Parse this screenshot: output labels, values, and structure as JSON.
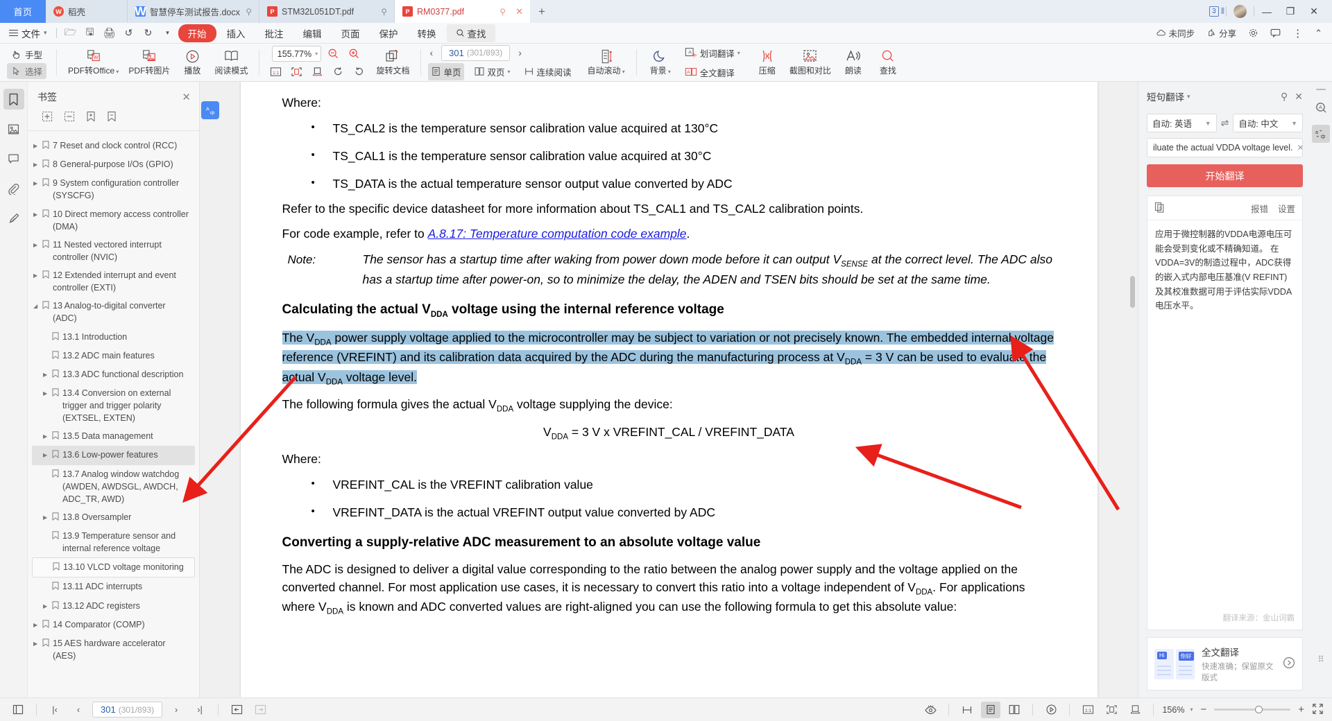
{
  "window": {
    "tabs": [
      {
        "label": "首页",
        "type": "home"
      },
      {
        "label": "稻壳",
        "type": "wps"
      },
      {
        "label": "智慧停车测试报告.docx",
        "type": "doc"
      },
      {
        "label": "STM32L051DT.pdf",
        "type": "pdf"
      },
      {
        "label": "RM0377.pdf",
        "type": "pdf"
      }
    ],
    "add_tab": "+",
    "tab_count": "3",
    "minimize": "—",
    "restore": "❐",
    "close": "✕"
  },
  "menubar": {
    "file": "文件",
    "items": [
      "开始",
      "插入",
      "批注",
      "编辑",
      "页面",
      "保护",
      "转换"
    ],
    "find": "查找",
    "right": [
      "未同步",
      "分享"
    ]
  },
  "toolbar": {
    "hand": "手型",
    "select": "选择",
    "pdf_to_office": "PDF转Office",
    "pdf_to_image": "PDF转图片",
    "play": "播放",
    "read_mode": "阅读模式",
    "zoom_value": "155.77%",
    "rotate_doc": "旋转文档",
    "page_current": "301",
    "page_total": "(301/893)",
    "single_page": "单页",
    "double_page": "双页",
    "continuous": "连续阅读",
    "auto_scroll": "自动滚动",
    "background": "背景",
    "word_translate": "划词翻译",
    "full_translate": "全文翻译",
    "compress": "压缩",
    "screenshot_compare": "截图和对比",
    "read_aloud": "朗读",
    "find": "查找"
  },
  "bookmarks": {
    "title": "书签",
    "items": [
      {
        "label": "7 Reset and clock control (RCC)",
        "level": 1,
        "arrow": true
      },
      {
        "label": "8 General-purpose I/Os (GPIO)",
        "level": 1,
        "arrow": true
      },
      {
        "label": "9 System configuration controller (SYSCFG)",
        "level": 1,
        "arrow": true
      },
      {
        "label": "10 Direct memory access controller (DMA)",
        "level": 1,
        "arrow": true
      },
      {
        "label": "11 Nested vectored interrupt controller (NVIC)",
        "level": 1,
        "arrow": true
      },
      {
        "label": "12 Extended interrupt and event controller (EXTI)",
        "level": 1,
        "arrow": true
      },
      {
        "label": "13 Analog-to-digital converter (ADC)",
        "level": 1,
        "arrow": true,
        "expanded": true
      },
      {
        "label": "13.1 Introduction",
        "level": 2,
        "arrow": false
      },
      {
        "label": "13.2 ADC main features",
        "level": 2,
        "arrow": false
      },
      {
        "label": "13.3 ADC functional description",
        "level": 2,
        "arrow": true
      },
      {
        "label": "13.4 Conversion on external trigger and trigger polarity (EXTSEL, EXTEN)",
        "level": 2,
        "arrow": true
      },
      {
        "label": "13.5 Data management",
        "level": 2,
        "arrow": true
      },
      {
        "label": "13.6 Low-power features",
        "level": 2,
        "arrow": true,
        "selected": true
      },
      {
        "label": "13.7 Analog window watchdog (AWDEN, AWDSGL, AWDCH, ADC_TR, AWD)",
        "level": 2,
        "arrow": false
      },
      {
        "label": "13.8 Oversampler",
        "level": 2,
        "arrow": true
      },
      {
        "label": "13.9 Temperature sensor and internal reference voltage",
        "level": 2,
        "arrow": false
      },
      {
        "label": "13.10 VLCD voltage monitoring",
        "level": 2,
        "arrow": false,
        "hover": true
      },
      {
        "label": "13.11 ADC interrupts",
        "level": 2,
        "arrow": false
      },
      {
        "label": "13.12 ADC registers",
        "level": 2,
        "arrow": true
      },
      {
        "label": "14 Comparator (COMP)",
        "level": 1,
        "arrow": true
      },
      {
        "label": "15 AES hardware accelerator (AES)",
        "level": 1,
        "arrow": true
      }
    ]
  },
  "document": {
    "where_1": "Where:",
    "bullets_1": [
      "TS_CAL2 is the temperature sensor calibration value acquired at 130°C",
      "TS_CAL1 is the temperature sensor calibration value acquired at 30°C",
      "TS_DATA is the actual temperature sensor output value converted by ADC"
    ],
    "refer_para": "Refer to the specific device datasheet for more information about TS_CAL1 and TS_CAL2 calibration points.",
    "code_example_pre": "For code example, refer to ",
    "code_example_link": "A.8.17: Temperature computation code example",
    "code_example_post": ".",
    "note_label": "Note:",
    "note_body_1": "The sensor has a startup time after waking from power down mode before it can output V",
    "note_body_sub": "SENSE",
    "note_body_2": " at the correct level. The ADC also has a startup time after power-on, so to minimize the delay, the ADEN and TSEN bits should be set at the same time.",
    "heading_1_a": "Calculating the actual V",
    "heading_1_sub": "DDA",
    "heading_1_b": " voltage using the internal reference voltage",
    "highlight_para": "The VDDA power supply voltage applied to the microcontroller may be subject to variation or not precisely known. The embedded internal voltage reference (VREFINT) and its calibration data acquired by the ADC during the manufacturing process at VDDA = 3 V can be used to evaluate the actual VDDA voltage level.",
    "formula_intro": "The following formula gives the actual VDDA voltage supplying the device:",
    "formula": "VDDA = 3 V x VREFINT_CAL / VREFINT_DATA",
    "where_2": "Where:",
    "bullets_2": [
      "VREFINT_CAL is the VREFINT calibration value",
      "VREFINT_DATA is the actual VREFINT output value converted by ADC"
    ],
    "heading_2": "Converting a supply-relative ADC measurement to an absolute voltage value",
    "last_para": "The ADC is designed to deliver a digital value corresponding to the ratio between the analog power supply and the voltage applied on the converted channel. For most application use cases, it is necessary to convert this ratio into a voltage independent of VDDA. For applications where VDDA is known and ADC converted values are right-aligned you can use the following formula to get this absolute value:"
  },
  "translate_panel": {
    "title": "短句翻译",
    "pin": "⚲",
    "close": "✕",
    "source_lang": "自动: 英语",
    "target_lang": "自动: 中文",
    "swap": "⇌",
    "source_text": "iluate the actual VDDA voltage level.",
    "clear": "✕",
    "translate_button": "开始翻译",
    "report": "报错",
    "settings": "设置",
    "result": "应用于微控制器的VDDA电源电压可能会受到变化或不精确知道。 在VDDA=3V的制造过程中，ADC获得的嵌入式内部电压基准(V REFINT)及其校准数据可用于评估实际VDDA电压水平。",
    "source_credit": "翻译来源：金山词霸",
    "promo_title": "全文翻译",
    "promo_sub": "快速准确；保留原文版式",
    "promo_chip_a": "Hi",
    "promo_chip_b": "你好"
  },
  "statusbar": {
    "page_current": "301",
    "page_total": "(301/893)",
    "zoom": "156%"
  },
  "colors": {
    "accent_blue": "#4a8af4",
    "accent_red": "#e8453c",
    "highlight": "#9cc3de",
    "translate_btn": "#e8605c",
    "arrow_red": "#e8201a"
  }
}
